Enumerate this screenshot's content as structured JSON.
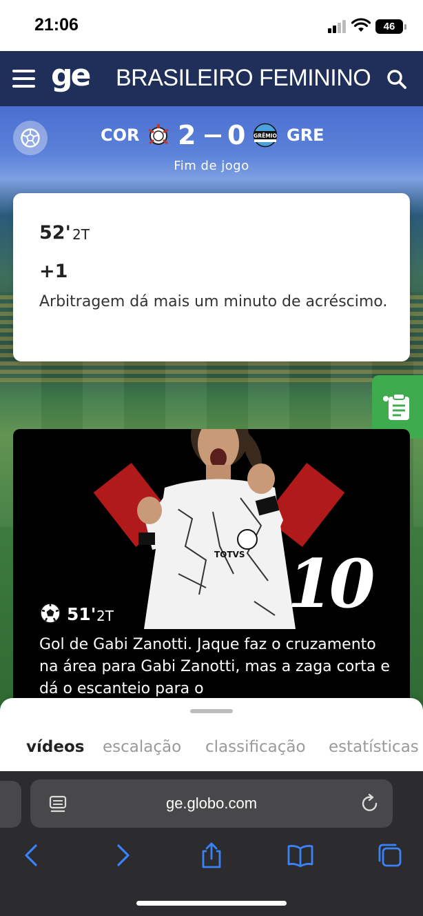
{
  "status_bar": {
    "time": "21:06",
    "battery": "46"
  },
  "header": {
    "logo": "ge",
    "section_title": "BRASILEIRO FEMININO"
  },
  "match": {
    "home_team": "COR",
    "away_team": "GRE",
    "home_score": "2",
    "away_score": "0",
    "status": "Fim de jogo",
    "away_crest_text": "GRÊMIO"
  },
  "events": [
    {
      "minute": "52'",
      "half": "2T",
      "extra": "+1",
      "text": "Arbitragem dá mais um minuto de acréscimo."
    },
    {
      "minute": "51'",
      "half": "2T",
      "jersey_number": "10",
      "text": "Gol de Gabi Zanotti. Jaque faz o cruzamento na área para Gabi Zanotti, mas a zaga corta e dá o escanteio para o"
    }
  ],
  "tabs": [
    {
      "label": "vídeos",
      "active": true
    },
    {
      "label": "escalação",
      "active": false
    },
    {
      "label": "classificação",
      "active": false
    },
    {
      "label": "estatísticas",
      "active": false
    }
  ],
  "browser": {
    "url": "ge.globo.com"
  },
  "colors": {
    "header_bg": "#1f2f5a",
    "accent_green": "#3dab4e",
    "safari_blue": "#3a82f7"
  },
  "icons": [
    "menu-icon",
    "search-icon",
    "soccer-ball-icon",
    "clipboard-icon",
    "reader-icon",
    "reload-icon",
    "back-icon",
    "forward-icon",
    "share-icon",
    "bookmarks-icon",
    "tabs-icon"
  ]
}
